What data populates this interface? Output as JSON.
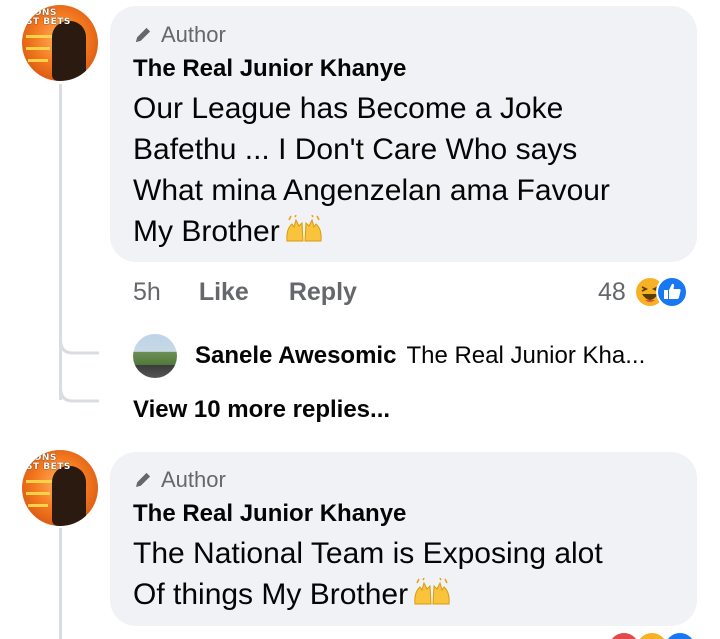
{
  "comments": [
    {
      "badge": "Author",
      "name": "The Real Junior Khanye",
      "text_lines": [
        "Our League has Become a Joke",
        "Bafethu ... I Don't Care Who says",
        "What mina Angenzelan ama Favour",
        "My Brother"
      ],
      "emoji": "raising-hands",
      "time": "5h",
      "like_label": "Like",
      "reply_label": "Reply",
      "reaction_count": "48",
      "avatar_text": [
        "IIONS",
        "ST BETS"
      ]
    },
    {
      "badge": "Author",
      "name": "The Real Junior Khanye",
      "text_lines": [
        "The National Team is Exposing alot",
        "Of things My Brother"
      ],
      "emoji": "raising-hands",
      "avatar_text": [
        "IIONS",
        "ST BETS"
      ]
    }
  ],
  "reply_preview": {
    "name": "Sanele Awesomic",
    "text": "The Real Junior Kha..."
  },
  "view_more": "View 10 more replies...",
  "colors": {
    "bubble": "#f0f2f5",
    "secondary_text": "#65676b",
    "like_blue": "#1877f2",
    "haha_yellow": "#f7b125"
  }
}
